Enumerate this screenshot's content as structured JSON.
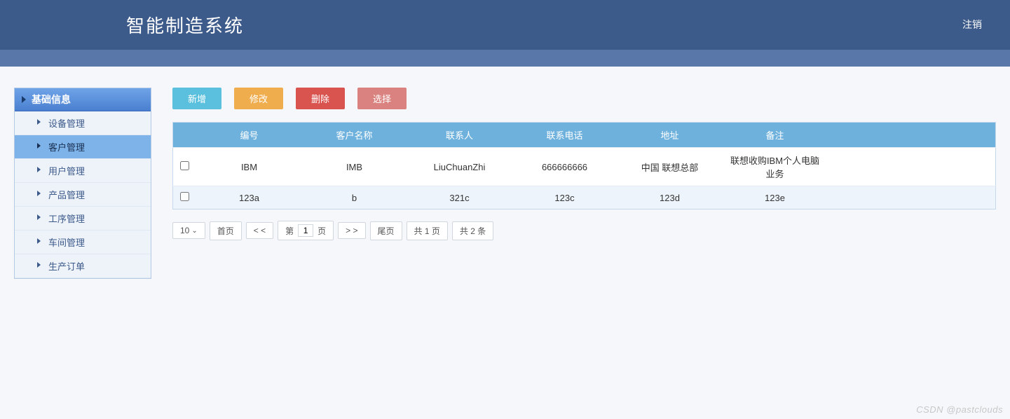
{
  "header": {
    "title": "智能制造系统",
    "logout": "注销"
  },
  "sidebar": {
    "section_title": "基础信息",
    "items": [
      {
        "label": "设备管理",
        "active": false
      },
      {
        "label": "客户管理",
        "active": true
      },
      {
        "label": "用户管理",
        "active": false
      },
      {
        "label": "产品管理",
        "active": false
      },
      {
        "label": "工序管理",
        "active": false
      },
      {
        "label": "车间管理",
        "active": false
      },
      {
        "label": "生产订单",
        "active": false
      }
    ]
  },
  "toolbar": {
    "add_label": "新增",
    "edit_label": "修改",
    "delete_label": "删除",
    "select_label": "选择"
  },
  "table": {
    "headers": [
      "编号",
      "客户名称",
      "联系人",
      "联系电话",
      "地址",
      "备注"
    ],
    "rows": [
      {
        "checked": false,
        "cells": [
          "IBM",
          "IMB",
          "LiuChuanZhi",
          "666666666",
          "中国 联想总部",
          "联想收购IBM个人电脑业务"
        ]
      },
      {
        "checked": false,
        "cells": [
          "123a",
          "b",
          "321c",
          "123c",
          "123d",
          "123e"
        ]
      }
    ]
  },
  "pager": {
    "page_size": "10",
    "first_label": "首页",
    "prev_label": "< <",
    "page_prefix": "第",
    "page_value": "1",
    "page_suffix": "页",
    "next_label": "> >",
    "last_label": "尾页",
    "total_pages": "共 1 页",
    "total_items": "共 2 条"
  },
  "watermark": "CSDN @pastclouds"
}
